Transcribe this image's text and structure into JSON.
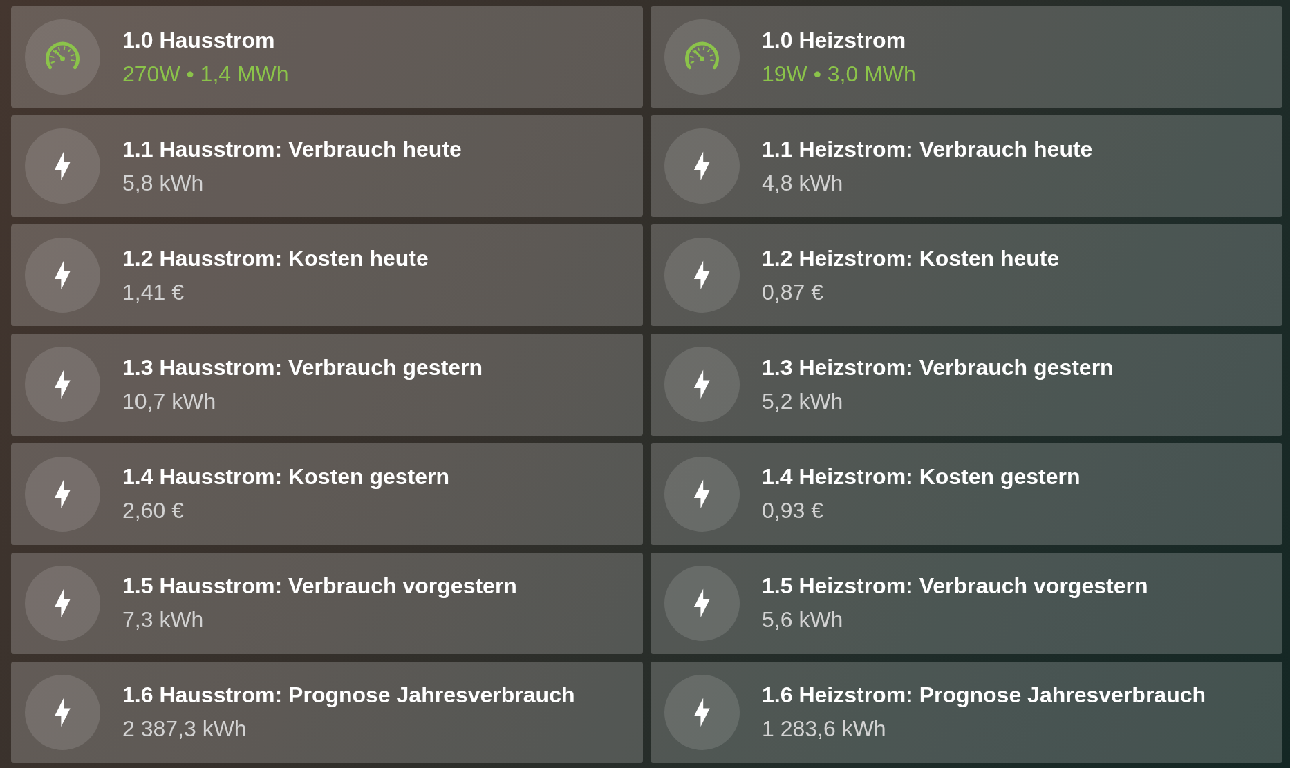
{
  "tiles": [
    {
      "kind": "gauge",
      "title": "1.0 Hausstrom",
      "value": "270W • 1,4 MWh"
    },
    {
      "kind": "gauge",
      "title": "1.0 Heizstrom",
      "value": "19W • 3,0 MWh"
    },
    {
      "kind": "energy",
      "title": "1.1 Hausstrom: Verbrauch heute",
      "value": "5,8 kWh"
    },
    {
      "kind": "energy",
      "title": "1.1 Heizstrom: Verbrauch heute",
      "value": "4,8 kWh"
    },
    {
      "kind": "energy",
      "title": "1.2 Hausstrom: Kosten heute",
      "value": "1,41 €"
    },
    {
      "kind": "energy",
      "title": "1.2 Heizstrom: Kosten heute",
      "value": "0,87 €"
    },
    {
      "kind": "energy",
      "title": "1.3 Hausstrom: Verbrauch gestern",
      "value": "10,7 kWh"
    },
    {
      "kind": "energy",
      "title": "1.3 Heizstrom: Verbrauch gestern",
      "value": "5,2 kWh"
    },
    {
      "kind": "energy",
      "title": "1.4 Hausstrom: Kosten gestern",
      "value": "2,60 €"
    },
    {
      "kind": "energy",
      "title": "1.4 Heizstrom: Kosten gestern",
      "value": "0,93 €"
    },
    {
      "kind": "energy",
      "title": "1.5 Hausstrom: Verbrauch vorgestern",
      "value": "7,3 kWh"
    },
    {
      "kind": "energy",
      "title": "1.5 Heizstrom: Verbrauch vorgestern",
      "value": "5,6 kWh"
    },
    {
      "kind": "energy",
      "title": "1.6 Hausstrom: Prognose Jahresverbrauch",
      "value": "2 387,3 kWh"
    },
    {
      "kind": "energy",
      "title": "1.6 Heizstrom: Prognose Jahresverbrauch",
      "value": "1 283,6 kWh"
    }
  ]
}
